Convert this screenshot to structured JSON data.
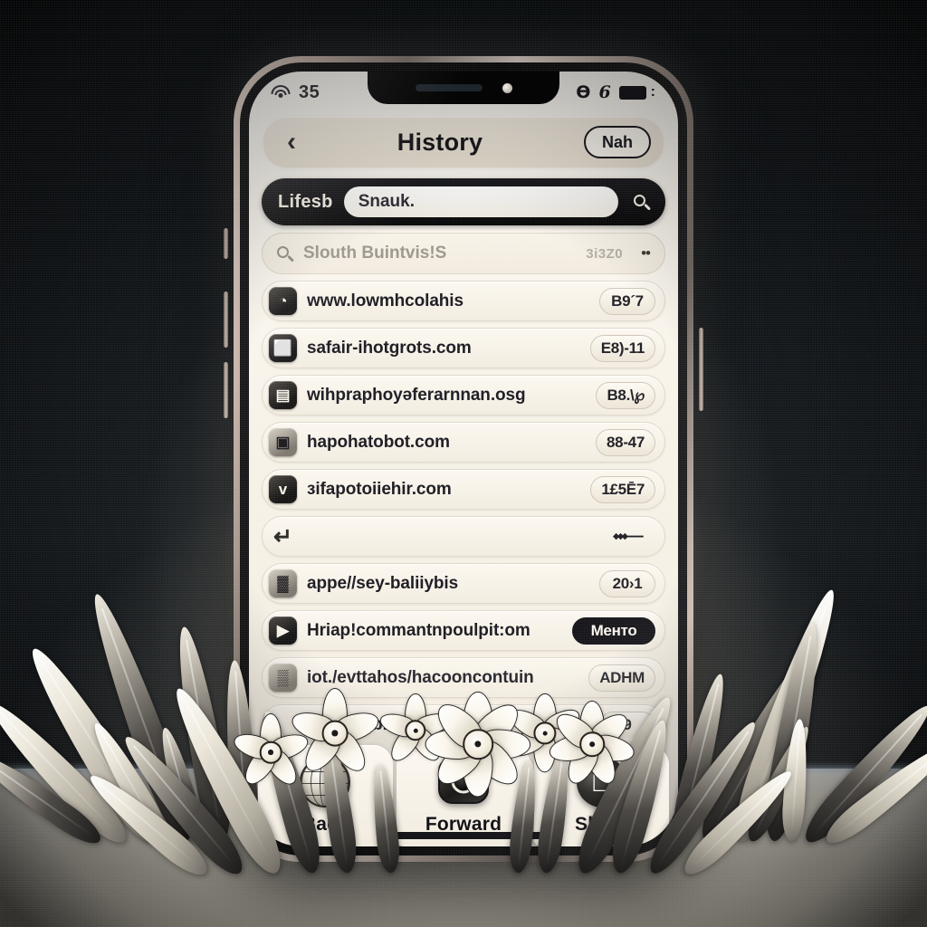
{
  "status_bar": {
    "wifi_icon": "wifi-icon",
    "carrier": "35",
    "right_glyph_1": "y-glyph-icon",
    "right_glyph_2": "6-glyph-icon",
    "battery_icon": "battery-icon",
    "battery_cap": ":"
  },
  "nav": {
    "back_icon": "chevron-left-icon",
    "title": "History",
    "new_label": "Nah"
  },
  "search": {
    "label": "Lifesb",
    "value": "Snauk.",
    "search_icon": "search-icon"
  },
  "suggestion": {
    "icon": "search-icon",
    "text": "Slouth Buintvis!S",
    "meta": "3i3Z0",
    "dots": "••"
  },
  "history": {
    "rows": [
      {
        "icon": "clock-icon",
        "glyph": "◔",
        "icon_style": "dark",
        "title": "www.lowmhcolahis",
        "badge": "B9´7",
        "badge_style": "light"
      },
      {
        "icon": "folder-icon",
        "glyph": "⬜",
        "icon_style": "dark",
        "title": "safair-ihotgrots.com",
        "badge": "E8)-11",
        "badge_style": "light"
      },
      {
        "icon": "news-icon",
        "glyph": "▤",
        "icon_style": "dark",
        "title": "wihpraphoyəferarnnan.osg",
        "badge": "B8.\\℘",
        "badge_style": "light"
      },
      {
        "icon": "photo-icon",
        "glyph": "▣",
        "icon_style": "pale",
        "title": "hapohatobot.com",
        "badge": "88-47",
        "badge_style": "light"
      },
      {
        "icon": "twitter-icon",
        "glyph": "ᴠ",
        "icon_style": "dark",
        "title": "зifapotoiiehir.com",
        "badge": "1£5Ē7",
        "badge_style": "light"
      },
      {
        "icon": "swirl-icon",
        "glyph": "↵",
        "icon_style": "naked",
        "title": "",
        "badge": "⬩⬩⬩—",
        "badge_style": "ghost"
      },
      {
        "icon": "qr-icon",
        "glyph": "▓",
        "icon_style": "pale",
        "title": "appe//sey-baliiybis",
        "badge": "20›1",
        "badge_style": "light"
      },
      {
        "icon": "play-icon",
        "glyph": "▶",
        "icon_style": "dark",
        "title": "Hriap!commantnpoulpit:om",
        "badge": "Менто",
        "badge_style": "dark"
      },
      {
        "icon": "document-icon",
        "glyph": "▒",
        "icon_style": "pale",
        "title": "iot./evttahos/hacooncontuin",
        "badge": "ADHM",
        "badge_style": "light"
      },
      {
        "icon": "blank-icon",
        "glyph": "",
        "icon_style": "naked",
        "title": "bau/negblcupk",
        "badge": "9",
        "badge_style": "light"
      }
    ]
  },
  "toolbar": {
    "buttons": [
      {
        "icon": "globe-icon",
        "label": "Back"
      },
      {
        "icon": "camera-icon",
        "label": "Forward"
      },
      {
        "icon": "apple-icon",
        "label": "Share",
        "glyph": ""
      }
    ]
  }
}
